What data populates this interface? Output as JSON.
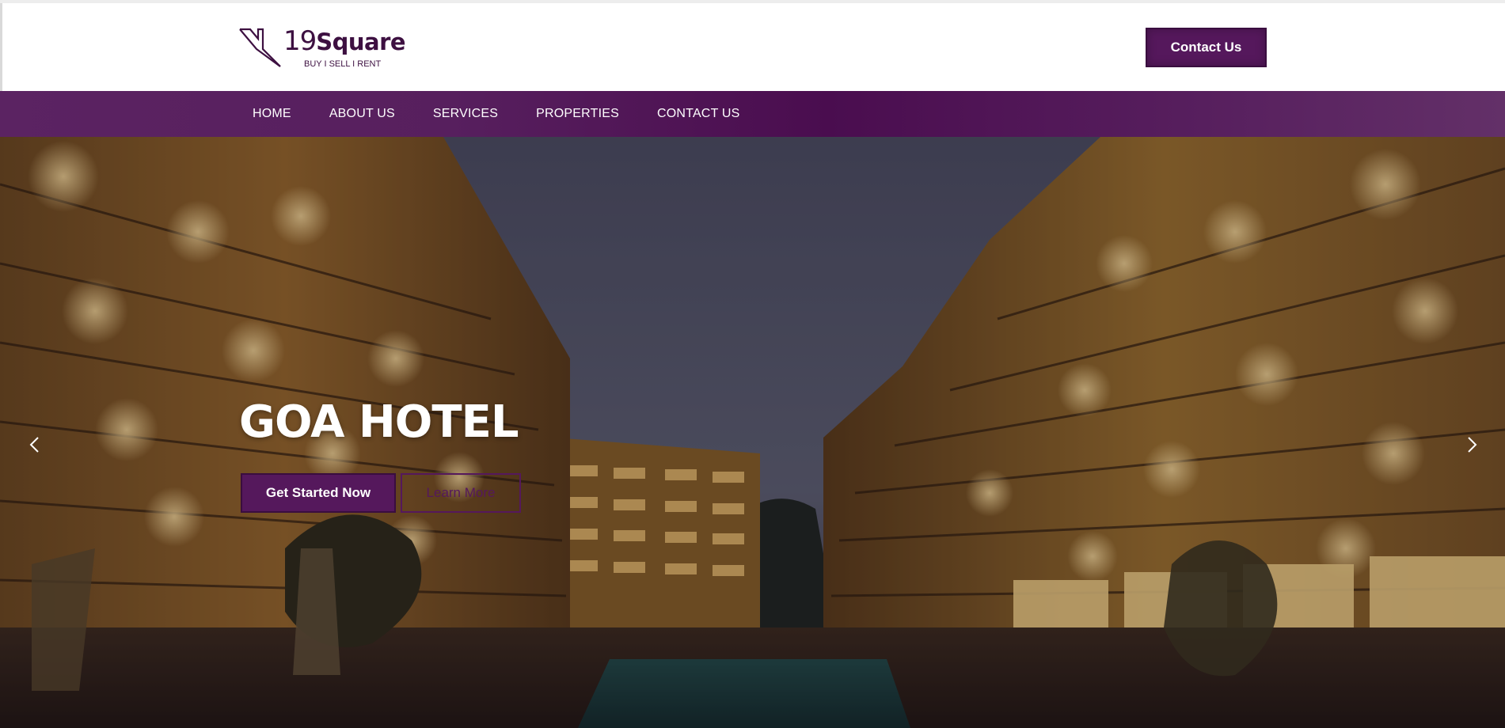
{
  "brand": {
    "number": "19",
    "name": "Square",
    "tagline": "BUY I SELL I RENT"
  },
  "header": {
    "contact_button": "Contact Us"
  },
  "nav": {
    "items": [
      {
        "label": "HOME"
      },
      {
        "label": "ABOUT US"
      },
      {
        "label": "SERVICES"
      },
      {
        "label": "PROPERTIES"
      },
      {
        "label": "CONTACT US"
      }
    ]
  },
  "hero": {
    "title": "GOA HOTEL",
    "primary_button": "Get Started Now",
    "secondary_button": "Learn More",
    "prev_icon": "chevron-left-icon",
    "next_icon": "chevron-right-icon"
  },
  "colors": {
    "brand_purple": "#55185c",
    "brand_dark": "#3d1041",
    "nav_bg": "#571f5e"
  }
}
